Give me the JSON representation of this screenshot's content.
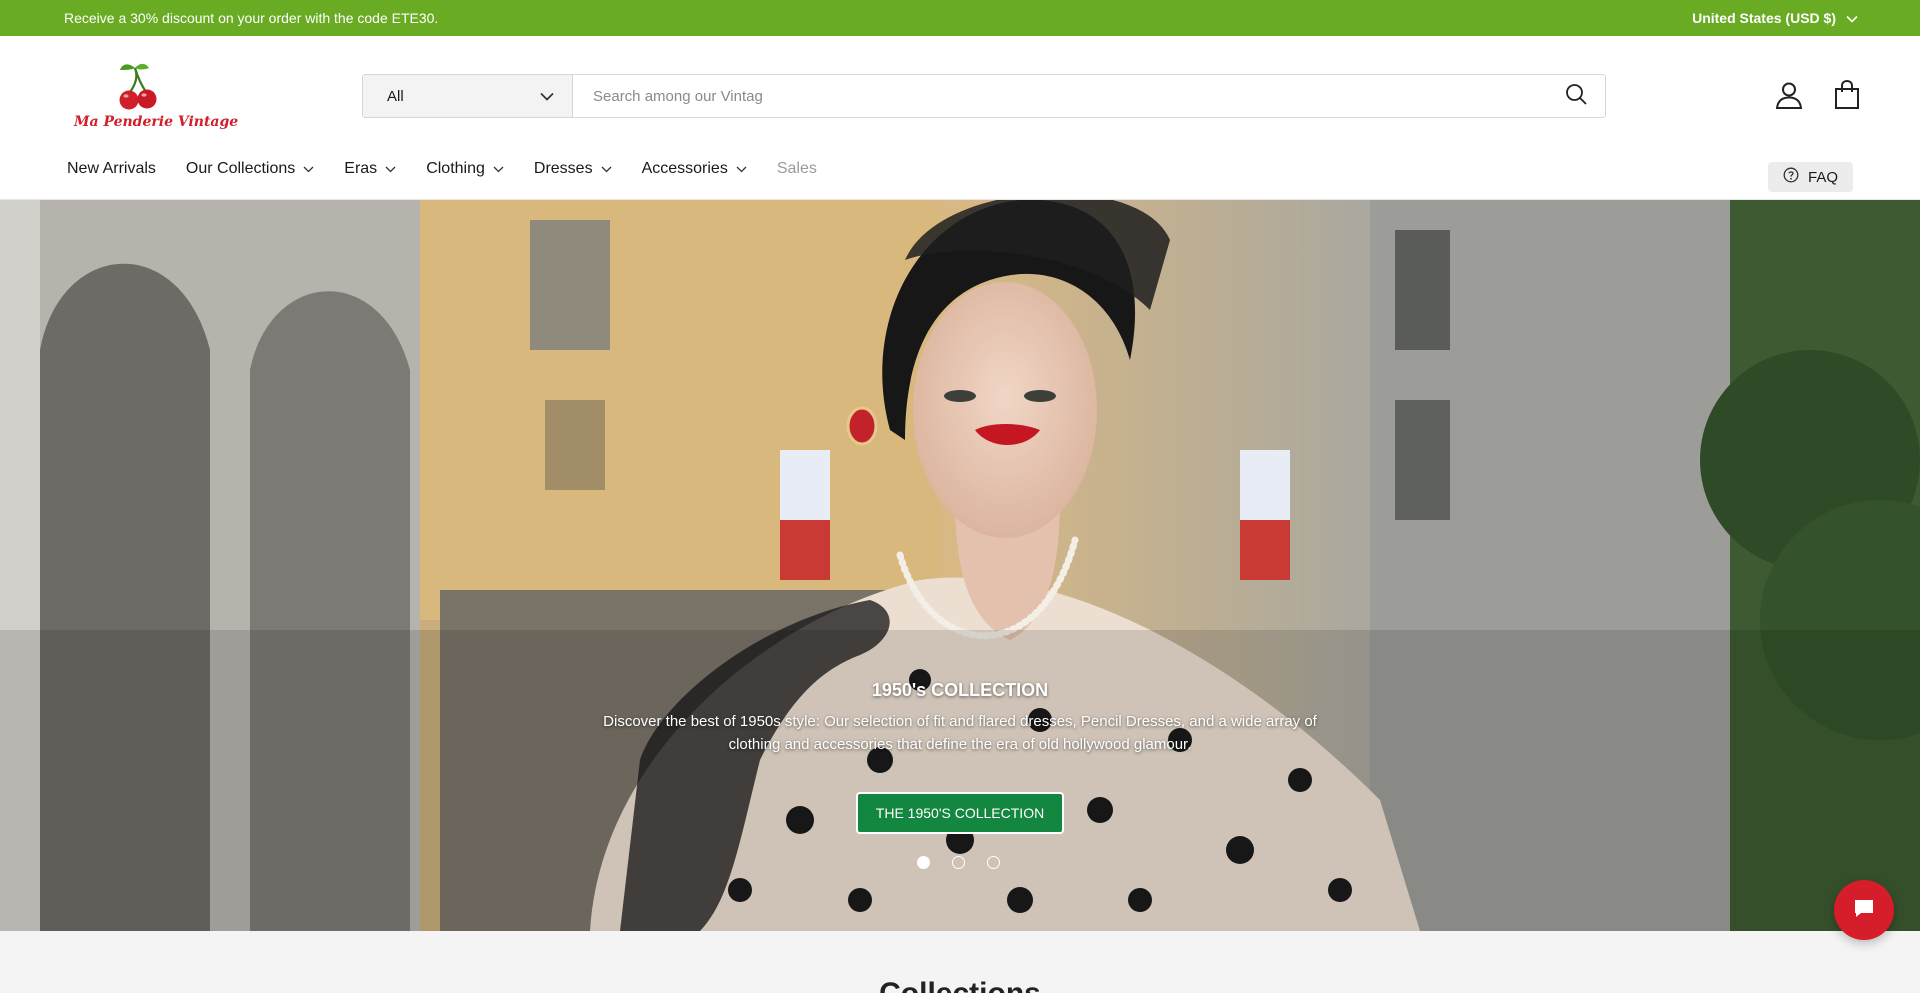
{
  "announcement": {
    "message": "Receive a 30% discount on your order with the code ETE30.",
    "currency": "United States (USD $)"
  },
  "logo": {
    "brand": "Ma Penderie Vintage"
  },
  "search": {
    "category": "All",
    "placeholder": "Search among our Vintag"
  },
  "nav": {
    "items": [
      {
        "label": "New Arrivals"
      },
      {
        "label": "Our Collections"
      },
      {
        "label": "Eras"
      },
      {
        "label": "Clothing"
      },
      {
        "label": "Dresses"
      },
      {
        "label": "Accessories"
      },
      {
        "label": "Sales"
      }
    ],
    "faq": "FAQ"
  },
  "hero": {
    "title": "1950's COLLECTION",
    "description": "Discover the best of 1950s style: Our selection of fit and flared dresses, Pencil Dresses, and a wide array of clothing and accessories that define the era of old hollywood glamour.",
    "cta": "THE 1950'S COLLECTION",
    "slide_count": 3,
    "active_slide": 1
  },
  "section": {
    "heading": "Collections"
  },
  "colors": {
    "announcement_bg": "#6aab24",
    "cta_bg": "#13863f",
    "chat_bg": "#d61d2a",
    "brand_red": "#d0202a"
  }
}
